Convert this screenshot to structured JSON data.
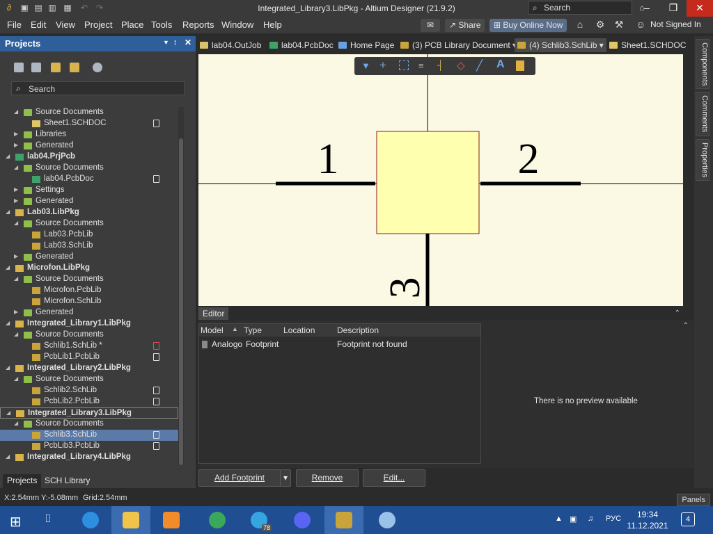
{
  "window": {
    "title": "Integrated_Library3.LibPkg - Altium Designer (21.9.2)",
    "search_placeholder": "Search"
  },
  "menu": {
    "items": [
      "File",
      "Edit",
      "View",
      "Project",
      "Place",
      "Tools",
      "Reports",
      "Window",
      "Help"
    ],
    "share": "Share",
    "buy": "Buy Online Now",
    "user": "Not Signed In"
  },
  "projects_panel": {
    "title": "Projects",
    "search_placeholder": "Search",
    "tree": [
      {
        "label": "Source Documents",
        "level": 2,
        "icon": "folder",
        "arrow": "down"
      },
      {
        "label": "Sheet1.SCHDOC",
        "level": 3,
        "icon": "sch",
        "doc": true
      },
      {
        "label": "Libraries",
        "level": 2,
        "icon": "folder",
        "arrow": "right"
      },
      {
        "label": "Generated",
        "level": 2,
        "icon": "folder",
        "arrow": "right"
      },
      {
        "label": "lab04.PrjPcb",
        "level": 1,
        "icon": "pcb",
        "arrow": "down",
        "bold": true
      },
      {
        "label": "Source Documents",
        "level": 2,
        "icon": "folder",
        "arrow": "down"
      },
      {
        "label": "lab04.PcbDoc",
        "level": 3,
        "icon": "pcb",
        "doc": true
      },
      {
        "label": "Settings",
        "level": 2,
        "icon": "folder",
        "arrow": "right"
      },
      {
        "label": "Generated",
        "level": 2,
        "icon": "folder",
        "arrow": "right"
      },
      {
        "label": "Lab03.LibPkg",
        "level": 1,
        "icon": "proj",
        "arrow": "down",
        "bold": true
      },
      {
        "label": "Source Documents",
        "level": 2,
        "icon": "folder",
        "arrow": "down"
      },
      {
        "label": "Lab03.PcbLib",
        "level": 3,
        "icon": "lib"
      },
      {
        "label": "Lab03.SchLib",
        "level": 3,
        "icon": "lib"
      },
      {
        "label": "Generated",
        "level": 2,
        "icon": "folder",
        "arrow": "right"
      },
      {
        "label": "Microfon.LibPkg",
        "level": 1,
        "icon": "proj",
        "arrow": "down",
        "bold": true
      },
      {
        "label": "Source Documents",
        "level": 2,
        "icon": "folder",
        "arrow": "down"
      },
      {
        "label": "Microfon.PcbLib",
        "level": 3,
        "icon": "lib"
      },
      {
        "label": "Microfon.SchLib",
        "level": 3,
        "icon": "lib"
      },
      {
        "label": "Generated",
        "level": 2,
        "icon": "folder",
        "arrow": "right"
      },
      {
        "label": "Integrated_Library1.LibPkg",
        "level": 1,
        "icon": "proj",
        "arrow": "down",
        "bold": true
      },
      {
        "label": "Source Documents",
        "level": 2,
        "icon": "folder",
        "arrow": "down"
      },
      {
        "label": "Schlib1.SchLib *",
        "level": 3,
        "icon": "lib",
        "doc": true,
        "modified": true
      },
      {
        "label": "PcbLib1.PcbLib",
        "level": 3,
        "icon": "lib",
        "doc": true
      },
      {
        "label": "Integrated_Library2.LibPkg",
        "level": 1,
        "icon": "proj",
        "arrow": "down",
        "bold": true
      },
      {
        "label": "Source Documents",
        "level": 2,
        "icon": "folder",
        "arrow": "down"
      },
      {
        "label": "Schlib2.SchLib",
        "level": 3,
        "icon": "lib",
        "doc": true
      },
      {
        "label": "PcbLib2.PcbLib",
        "level": 3,
        "icon": "lib",
        "doc": true
      },
      {
        "label": "Integrated_Library3.LibPkg",
        "level": 1,
        "icon": "proj",
        "arrow": "down",
        "bold": true,
        "outlined": true
      },
      {
        "label": "Source Documents",
        "level": 2,
        "icon": "folder",
        "arrow": "down"
      },
      {
        "label": "Schlib3.SchLib",
        "level": 3,
        "icon": "lib",
        "doc": true,
        "selected": true
      },
      {
        "label": "PcbLib3.PcbLib",
        "level": 3,
        "icon": "lib",
        "doc": true
      },
      {
        "label": "Integrated_Library4.LibPkg",
        "level": 1,
        "icon": "proj",
        "arrow": "down",
        "bold": true
      }
    ],
    "tabs": [
      "Projects",
      "SCH Library"
    ]
  },
  "doc_tabs": [
    {
      "label": "lab04.OutJob",
      "color": "#d9c26a"
    },
    {
      "label": "lab04.PcbDoc",
      "color": "#3da36a"
    },
    {
      "label": "Home Page",
      "color": "#6aa0e0"
    },
    {
      "label": "(3) PCB Library Document",
      "color": "#c9a43b"
    },
    {
      "label": "(4) Schlib3.SchLib",
      "color": "#c9a43b",
      "active": true
    },
    {
      "label": "Sheet1.SCHDOC",
      "color": "#e0c468"
    }
  ],
  "right_tabs": [
    "Components",
    "Comments",
    "Properties"
  ],
  "schematic": {
    "pin_labels": [
      "1",
      "2",
      "3"
    ]
  },
  "editor": {
    "title": "Editor",
    "columns": [
      "Model",
      "Type",
      "Location",
      "Description"
    ],
    "rows": [
      {
        "model": "Analogo",
        "type": "Footprint",
        "location": "",
        "description": "Footprint not found"
      }
    ],
    "preview_text": "There is no preview available",
    "buttons": {
      "add": "Add Footprint",
      "remove": "Remove",
      "edit": "Edit..."
    }
  },
  "status": {
    "coords": "X:2.54mm Y:-5.08mm",
    "grid": "Grid:2.54mm",
    "panels": "Panels"
  },
  "taskbar": {
    "lang": "РУС",
    "time": "19:34",
    "date": "11.12.2021",
    "notifications": "4",
    "telegram_badge": "78"
  }
}
